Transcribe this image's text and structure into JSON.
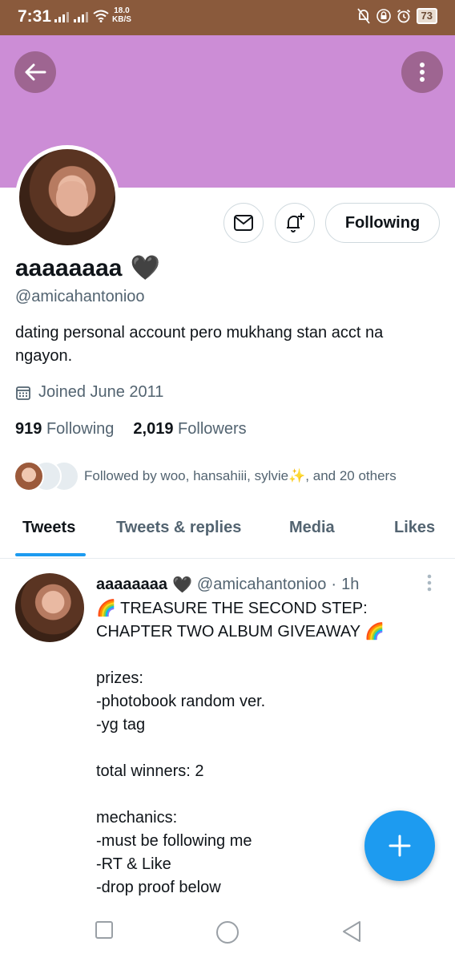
{
  "status_bar": {
    "time": "7:31",
    "speed_value": "18.0",
    "speed_unit": "KB/S",
    "battery": "73",
    "icons": [
      "signal-icon",
      "signal-icon",
      "wifi-icon",
      "notifications-off-icon",
      "lock-icon",
      "alarm-icon",
      "battery-icon"
    ]
  },
  "colors": {
    "banner": "#cc8dd6",
    "accent": "#1d9bf0",
    "status_bar": "#8a5a3c",
    "secondary_text": "#536471"
  },
  "header": {
    "back_icon": "arrow-left-icon",
    "more_icon": "more-vertical-icon"
  },
  "profile": {
    "display_name": "aaaaaaaa",
    "name_emoji": "🖤",
    "handle": "@amicahantonioo",
    "bio": "dating personal account pero mukhang stan acct na ngayon.",
    "joined": "Joined June 2011",
    "following_count": "919",
    "following_label": "Following",
    "followers_count": "2,019",
    "followers_label": "Followers",
    "followed_by": "Followed by woo, hansahiii, sylvie✨, and 20 others",
    "follow_button_label": "Following"
  },
  "tabs": [
    {
      "label": "Tweets",
      "active": true
    },
    {
      "label": "Tweets & replies",
      "active": false
    },
    {
      "label": "Media",
      "active": false
    },
    {
      "label": "Likes",
      "active": false
    }
  ],
  "tweet": {
    "name": "aaaaaaaa",
    "name_emoji": "🖤",
    "handle": "@amicahantonioo",
    "separator": "·",
    "time": "1h",
    "lines": [
      "🌈 TREASURE THE SECOND STEP:",
      "CHAPTER TWO ALBUM GIVEAWAY 🌈",
      "",
      "prizes:",
      "-photobook random ver.",
      "-yg tag",
      "",
      "total winners: 2",
      "",
      "mechanics:",
      "-must be following me",
      "-RT & Like",
      "-drop proof below"
    ]
  },
  "fab_icon": "plus-icon",
  "nav_bar": {
    "icons": [
      "recents-icon",
      "home-icon",
      "back-icon"
    ]
  }
}
